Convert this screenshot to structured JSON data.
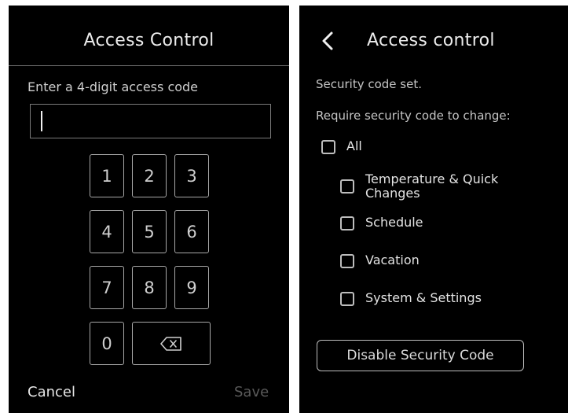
{
  "left": {
    "title": "Access Control",
    "prompt": "Enter a 4-digit access code",
    "code_value": "",
    "keys": [
      "1",
      "2",
      "3",
      "4",
      "5",
      "6",
      "7",
      "8",
      "9",
      "0"
    ],
    "backspace_icon": "backspace-icon",
    "cancel_label": "Cancel",
    "save_label": "Save"
  },
  "right": {
    "title": "Access control",
    "back_icon": "chevron-left-icon",
    "status": "Security code set.",
    "require_label": "Require security code to change:",
    "options": [
      {
        "label": "All",
        "checked": false
      },
      {
        "label": "Temperature & Quick Changes",
        "checked": false
      },
      {
        "label": "Schedule",
        "checked": false
      },
      {
        "label": "Vacation",
        "checked": false
      },
      {
        "label": "System & Settings",
        "checked": false
      }
    ],
    "disable_label": "Disable Security Code"
  },
  "colors": {
    "background": "#000000",
    "text": "#e9e9e9",
    "disabled_text": "#5a5a5a",
    "border": "#a8a8a8"
  }
}
